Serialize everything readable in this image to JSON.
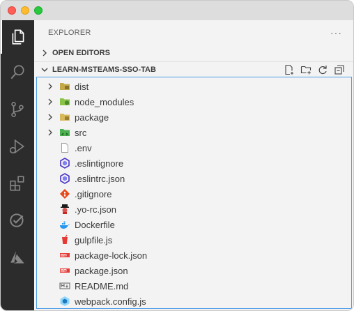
{
  "explorer": {
    "title": "EXPLORER",
    "more_label": "···"
  },
  "sections": {
    "open_editors": "OPEN EDITORS",
    "project": "LEARN-MSTEAMS-SSO-TAB"
  },
  "tree": [
    {
      "name": "dist",
      "kind": "folder",
      "icon": "folder-dist-icon"
    },
    {
      "name": "node_modules",
      "kind": "folder",
      "icon": "folder-node-icon"
    },
    {
      "name": "package",
      "kind": "folder",
      "icon": "folder-package-icon"
    },
    {
      "name": "src",
      "kind": "folder",
      "icon": "folder-src-icon"
    },
    {
      "name": ".env",
      "kind": "file",
      "icon": "file-icon"
    },
    {
      "name": ".eslintignore",
      "kind": "file",
      "icon": "eslint-icon"
    },
    {
      "name": ".eslintrc.json",
      "kind": "file",
      "icon": "eslint-icon"
    },
    {
      "name": ".gitignore",
      "kind": "file",
      "icon": "git-icon"
    },
    {
      "name": ".yo-rc.json",
      "kind": "file",
      "icon": "yeoman-icon"
    },
    {
      "name": "Dockerfile",
      "kind": "file",
      "icon": "docker-icon"
    },
    {
      "name": "gulpfile.js",
      "kind": "file",
      "icon": "gulp-icon"
    },
    {
      "name": "package-lock.json",
      "kind": "file",
      "icon": "npm-icon"
    },
    {
      "name": "package.json",
      "kind": "file",
      "icon": "npm-icon"
    },
    {
      "name": "README.md",
      "kind": "file",
      "icon": "markdown-icon"
    },
    {
      "name": "webpack.config.js",
      "kind": "file",
      "icon": "webpack-icon"
    }
  ],
  "colors": {
    "activity_bar": "#2c2c2c",
    "sidebar": "#f3f3f3",
    "focus_border": "#4a9be8"
  }
}
